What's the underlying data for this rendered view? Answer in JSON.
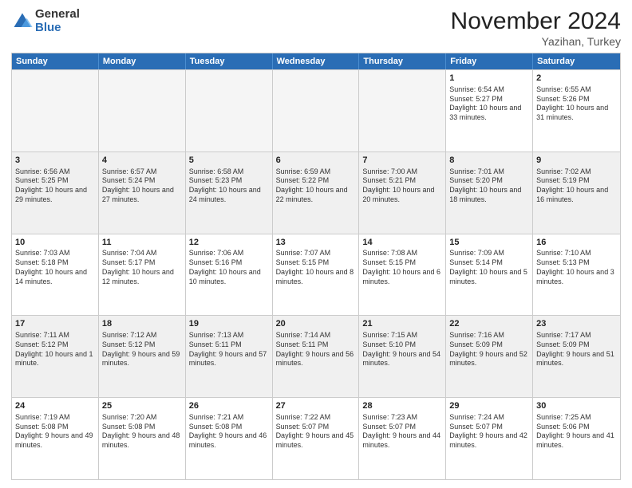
{
  "logo": {
    "general": "General",
    "blue": "Blue"
  },
  "title": "November 2024",
  "location": "Yazihan, Turkey",
  "days": [
    "Sunday",
    "Monday",
    "Tuesday",
    "Wednesday",
    "Thursday",
    "Friday",
    "Saturday"
  ],
  "rows": [
    [
      {
        "day": "",
        "empty": true
      },
      {
        "day": "",
        "empty": true
      },
      {
        "day": "",
        "empty": true
      },
      {
        "day": "",
        "empty": true
      },
      {
        "day": "",
        "empty": true
      },
      {
        "day": "1",
        "sunrise": "6:54 AM",
        "sunset": "5:27 PM",
        "daylight": "10 hours and 33 minutes."
      },
      {
        "day": "2",
        "sunrise": "6:55 AM",
        "sunset": "5:26 PM",
        "daylight": "10 hours and 31 minutes."
      }
    ],
    [
      {
        "day": "3",
        "sunrise": "6:56 AM",
        "sunset": "5:25 PM",
        "daylight": "10 hours and 29 minutes."
      },
      {
        "day": "4",
        "sunrise": "6:57 AM",
        "sunset": "5:24 PM",
        "daylight": "10 hours and 27 minutes."
      },
      {
        "day": "5",
        "sunrise": "6:58 AM",
        "sunset": "5:23 PM",
        "daylight": "10 hours and 24 minutes."
      },
      {
        "day": "6",
        "sunrise": "6:59 AM",
        "sunset": "5:22 PM",
        "daylight": "10 hours and 22 minutes."
      },
      {
        "day": "7",
        "sunrise": "7:00 AM",
        "sunset": "5:21 PM",
        "daylight": "10 hours and 20 minutes."
      },
      {
        "day": "8",
        "sunrise": "7:01 AM",
        "sunset": "5:20 PM",
        "daylight": "10 hours and 18 minutes."
      },
      {
        "day": "9",
        "sunrise": "7:02 AM",
        "sunset": "5:19 PM",
        "daylight": "10 hours and 16 minutes."
      }
    ],
    [
      {
        "day": "10",
        "sunrise": "7:03 AM",
        "sunset": "5:18 PM",
        "daylight": "10 hours and 14 minutes."
      },
      {
        "day": "11",
        "sunrise": "7:04 AM",
        "sunset": "5:17 PM",
        "daylight": "10 hours and 12 minutes."
      },
      {
        "day": "12",
        "sunrise": "7:06 AM",
        "sunset": "5:16 PM",
        "daylight": "10 hours and 10 minutes."
      },
      {
        "day": "13",
        "sunrise": "7:07 AM",
        "sunset": "5:15 PM",
        "daylight": "10 hours and 8 minutes."
      },
      {
        "day": "14",
        "sunrise": "7:08 AM",
        "sunset": "5:15 PM",
        "daylight": "10 hours and 6 minutes."
      },
      {
        "day": "15",
        "sunrise": "7:09 AM",
        "sunset": "5:14 PM",
        "daylight": "10 hours and 5 minutes."
      },
      {
        "day": "16",
        "sunrise": "7:10 AM",
        "sunset": "5:13 PM",
        "daylight": "10 hours and 3 minutes."
      }
    ],
    [
      {
        "day": "17",
        "sunrise": "7:11 AM",
        "sunset": "5:12 PM",
        "daylight": "10 hours and 1 minute."
      },
      {
        "day": "18",
        "sunrise": "7:12 AM",
        "sunset": "5:12 PM",
        "daylight": "9 hours and 59 minutes."
      },
      {
        "day": "19",
        "sunrise": "7:13 AM",
        "sunset": "5:11 PM",
        "daylight": "9 hours and 57 minutes."
      },
      {
        "day": "20",
        "sunrise": "7:14 AM",
        "sunset": "5:11 PM",
        "daylight": "9 hours and 56 minutes."
      },
      {
        "day": "21",
        "sunrise": "7:15 AM",
        "sunset": "5:10 PM",
        "daylight": "9 hours and 54 minutes."
      },
      {
        "day": "22",
        "sunrise": "7:16 AM",
        "sunset": "5:09 PM",
        "daylight": "9 hours and 52 minutes."
      },
      {
        "day": "23",
        "sunrise": "7:17 AM",
        "sunset": "5:09 PM",
        "daylight": "9 hours and 51 minutes."
      }
    ],
    [
      {
        "day": "24",
        "sunrise": "7:19 AM",
        "sunset": "5:08 PM",
        "daylight": "9 hours and 49 minutes."
      },
      {
        "day": "25",
        "sunrise": "7:20 AM",
        "sunset": "5:08 PM",
        "daylight": "9 hours and 48 minutes."
      },
      {
        "day": "26",
        "sunrise": "7:21 AM",
        "sunset": "5:08 PM",
        "daylight": "9 hours and 46 minutes."
      },
      {
        "day": "27",
        "sunrise": "7:22 AM",
        "sunset": "5:07 PM",
        "daylight": "9 hours and 45 minutes."
      },
      {
        "day": "28",
        "sunrise": "7:23 AM",
        "sunset": "5:07 PM",
        "daylight": "9 hours and 44 minutes."
      },
      {
        "day": "29",
        "sunrise": "7:24 AM",
        "sunset": "5:07 PM",
        "daylight": "9 hours and 42 minutes."
      },
      {
        "day": "30",
        "sunrise": "7:25 AM",
        "sunset": "5:06 PM",
        "daylight": "9 hours and 41 minutes."
      }
    ]
  ]
}
